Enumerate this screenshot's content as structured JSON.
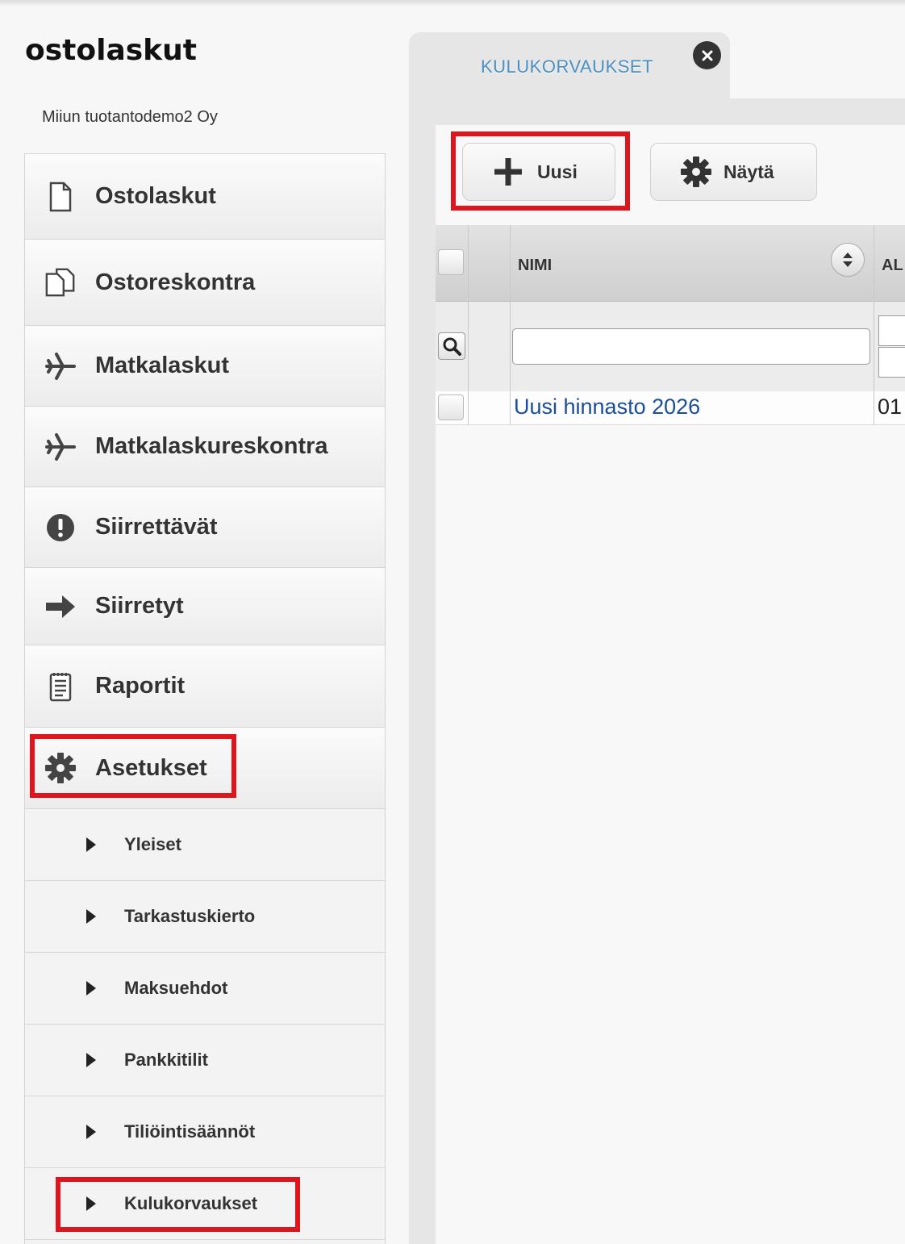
{
  "app": {
    "title": "ostolaskut",
    "company": "Miiun tuotantodemo2 Oy"
  },
  "sidebar": {
    "items": [
      {
        "label": "Ostolaskut",
        "icon": "document-icon"
      },
      {
        "label": "Ostoreskontra",
        "icon": "documents-icon"
      },
      {
        "label": "Matkalaskut",
        "icon": "airplane-icon"
      },
      {
        "label": "Matkalaskureskontra",
        "icon": "airplane-icon"
      },
      {
        "label": "Siirrettävät",
        "icon": "alert-icon"
      },
      {
        "label": "Siirretyt",
        "icon": "arrow-right-icon"
      },
      {
        "label": "Raportit",
        "icon": "report-icon"
      },
      {
        "label": "Asetukset",
        "icon": "gear-icon",
        "expanded": true
      }
    ],
    "subitems": [
      {
        "label": "Yleiset"
      },
      {
        "label": "Tarkastuskierto"
      },
      {
        "label": "Maksuehdot"
      },
      {
        "label": "Pankkitilit"
      },
      {
        "label": "Tiliöintisäännöt"
      },
      {
        "label": "Kulukorvaukset"
      }
    ]
  },
  "tabs": [
    {
      "label": "KULUKORVAUKSET",
      "active": true
    }
  ],
  "toolbar": {
    "new_label": "Uusi",
    "show_label": "Näytä"
  },
  "grid": {
    "columns": [
      "NIMI",
      "AL"
    ],
    "filter": {
      "name_value": "",
      "name_placeholder": ""
    },
    "rows": [
      {
        "name": "Uusi hinnasto 2026",
        "col2": "01"
      }
    ]
  },
  "colors": {
    "highlight": "#e0141c",
    "link": "#1a4e9c",
    "tab_text": "#4a8fbf"
  }
}
